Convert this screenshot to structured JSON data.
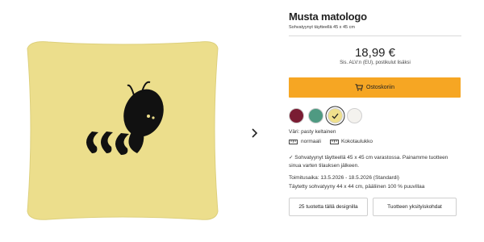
{
  "product": {
    "title": "Musta matologo",
    "subtitle": "Sohvatyynyt täytteellä 45 x 45 cm",
    "price": "18,99 €",
    "tax_note": "Sis. ALV:n (EU), postikulut lisäksi",
    "add_to_cart_label": "Ostoskoriin",
    "color_label": "Väri: pasty keltainen",
    "size_normal": "normaali",
    "size_table": "Kokotaulukko",
    "stock_note": "✓ Sohvatyynyt täytteellä 45 x 45 cm varastossa. Painamme tuotteen sinua varten tilauksen jälkeen.",
    "delivery": "Toimitusaika: 13.5.2026 - 18.5.2026 (Standardi)",
    "filling": "Täytetty sohvatyyny 44 x 44 cm, pääliinen 100 % puuvillaa",
    "more_designs_button": "25 tuotetta tällä designilla",
    "details_button": "Tuotteen yksityiskohdat"
  },
  "swatches": [
    {
      "name": "burgundy",
      "color": "#7a1c33",
      "selected": false
    },
    {
      "name": "teal",
      "color": "#4f9a82",
      "selected": false
    },
    {
      "name": "pastel yellow",
      "color": "#f0e08c",
      "selected": true
    },
    {
      "name": "white",
      "color": "#f4f2ee",
      "selected": false
    }
  ],
  "colors": {
    "accent": "#f6a623",
    "pillow": "#ecde8c",
    "logo": "#111111"
  },
  "icons": {
    "cart": "shopping-cart-icon",
    "next": "chevron-right-icon",
    "ruler": "ruler-icon",
    "check": "check-icon"
  }
}
